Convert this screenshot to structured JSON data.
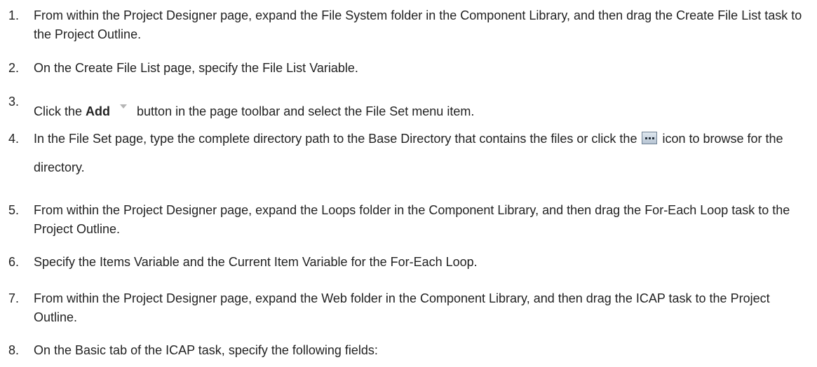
{
  "steps": [
    {
      "number": "1.",
      "text": "From within the Project Designer page, expand the File System folder in the Component Library, and then drag the Create File List task to the Project Outline."
    },
    {
      "number": "2.",
      "text": "On the Create File List page, specify the File List Variable."
    },
    {
      "number": "3.",
      "before": "Click the ",
      "bold": "Add",
      "after": "button in the page toolbar and select the File Set menu item.",
      "icon": "dropdown-arrow-icon"
    },
    {
      "number": "4.",
      "before": "In the File Set page, type the complete directory path to the Base Directory that contains the files or click the ",
      "after": " icon to browse for the directory.",
      "icon": "browse-ellipsis-icon"
    },
    {
      "number": "5.",
      "text": "From within the Project Designer page, expand the Loops folder in the Component Library, and then drag the For-Each Loop task to the Project Outline."
    },
    {
      "number": "6.",
      "text": "Specify the Items Variable and the Current Item Variable for the For-Each Loop."
    },
    {
      "number": "7.",
      "text": "From within the Project Designer page, expand the Web folder in the Component Library, and then drag the ICAP task to the Project Outline."
    },
    {
      "number": "8.",
      "text": "On the Basic tab of the ICAP task, specify the following fields:"
    }
  ]
}
